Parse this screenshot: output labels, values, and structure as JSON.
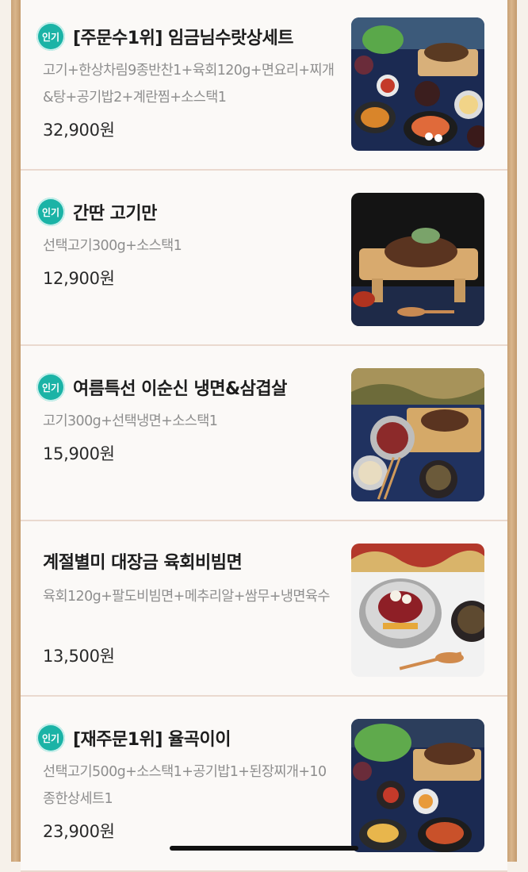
{
  "items": [
    {
      "badge": "인기",
      "title": "[주문수1위] 임금님수랏상세트",
      "desc": "고기+한상차림9종반찬1+육회120g+면요리+찌개&탕+공기밥2+계란찜+소스택1",
      "price": "32,900원"
    },
    {
      "badge": "인기",
      "title": "간딴 고기만",
      "desc": "선택고기300g+소스택1",
      "price": "12,900원"
    },
    {
      "badge": "인기",
      "title": "여름특선 이순신 냉면&삼겹살",
      "desc": "고기300g+선택냉면+소스택1",
      "price": "15,900원"
    },
    {
      "title": "계절별미 대장금 육회비빔면",
      "desc": "육회120g+팔도비빔면+메추리알+쌈무+냉면육수",
      "price": "13,500원"
    },
    {
      "badge": "인기",
      "title": "[재주문1위] 율곡이이",
      "desc": "선택고기500g+소스택1+공기밥1+된장찌개+10종한상세트1",
      "price": "23,900원"
    }
  ]
}
